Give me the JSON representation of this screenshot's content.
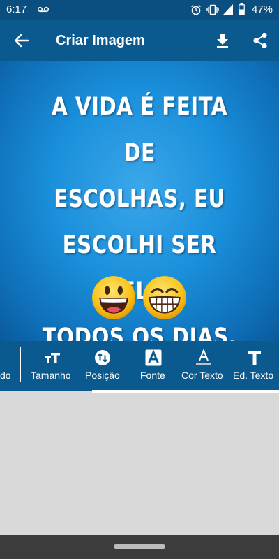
{
  "status_bar": {
    "time": "6:17",
    "battery_percent": "47%",
    "icons": [
      "voicemail-icon",
      "alarm-icon",
      "vibrate-icon",
      "signal-icon",
      "battery-icon"
    ]
  },
  "app_bar": {
    "title": "Criar Imagem",
    "icons": [
      "back-arrow-icon",
      "download-icon",
      "share-icon"
    ]
  },
  "canvas": {
    "quote_lines": [
      "A VIDA É FEITA DE",
      "ESCOLHAS, EU",
      "ESCOLHI SER FELIZ",
      "TODOS OS DIAS."
    ],
    "emojis": [
      "grinning-face",
      "beaming-face-with-smiling-eyes"
    ],
    "background_color": "#1a8fdb"
  },
  "toolbar": {
    "partial_label": "do",
    "items": [
      {
        "label": "Tamanho",
        "icon": "text-size-icon"
      },
      {
        "label": "Posição",
        "icon": "position-icon"
      },
      {
        "label": "Fonte",
        "icon": "font-icon"
      },
      {
        "label": "Cor Texto",
        "icon": "text-color-icon"
      },
      {
        "label": "Ed. Texto",
        "icon": "edit-text-icon"
      }
    ]
  },
  "colors": {
    "status_bar": "#0a4f80",
    "app_bar": "#0b5a8f",
    "toolbar": "#0b5a8f",
    "empty_area": "#d9d9d9",
    "nav_bar": "#3c3c3c"
  }
}
